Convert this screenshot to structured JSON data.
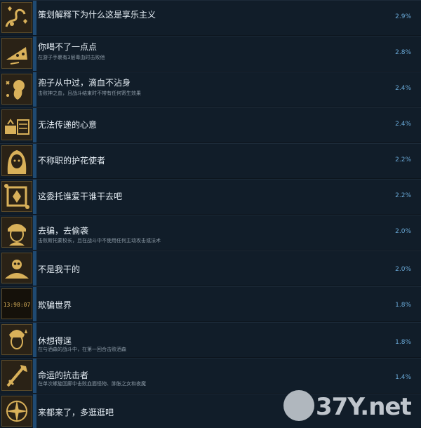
{
  "achievements": [
    {
      "title": "策划解释下为什么这是享乐主义",
      "desc": "",
      "pct": "2.9%",
      "icon": "hearts-swirl-icon"
    },
    {
      "title": "你喝不了一点点",
      "desc": "在游子手裹有3层毒血时击败他",
      "pct": "2.8%",
      "icon": "cheese-wedge-icon"
    },
    {
      "title": "孢子从中过，滴血不沾身",
      "desc": "击败神之血，且战斗结束时不带有任何寄生效果",
      "pct": "2.4%",
      "icon": "spore-creature-icon"
    },
    {
      "title": "无法传递的心意",
      "desc": "",
      "pct": "2.4%",
      "icon": "letter-scene-icon"
    },
    {
      "title": "不称职的护花使者",
      "desc": "",
      "pct": "2.2%",
      "icon": "girl-portrait-icon"
    },
    {
      "title": "这委托谁爱干谁干去吧",
      "desc": "",
      "pct": "2.2%",
      "icon": "ornate-frame-icon"
    },
    {
      "title": "去骗，去偷袭",
      "desc": "击败斯托蒙校长，且在战斗中不使用任何主动攻击或法术",
      "pct": "2.0%",
      "icon": "boy-portrait-icon"
    },
    {
      "title": "不是我干的",
      "desc": "",
      "pct": "2.0%",
      "icon": "skull-pile-icon"
    },
    {
      "title": "欺骗世界",
      "desc": "",
      "pct": "1.8%",
      "icon": "digital-counter-icon",
      "icon_text": "13:98:07"
    },
    {
      "title": "休想得逞",
      "desc": "在与洒森的战斗中，在第一回合击败洒森",
      "pct": "1.8%",
      "icon": "hero-portrait-icon"
    },
    {
      "title": "命运的抗击者",
      "desc": "在单次螺旋回廊中击败血面怪物、肿胀之女和夜魔",
      "pct": "1.4%",
      "icon": "sword-icon"
    },
    {
      "title": "来都来了，多逛逛吧",
      "desc": "",
      "pct": "",
      "icon": "compass-rose-icon"
    }
  ],
  "watermark": {
    "text": "37Y.net"
  },
  "colors": {
    "accent": "#1f4a72",
    "percent": "#69a8d6",
    "gold": "#d9b15a"
  }
}
